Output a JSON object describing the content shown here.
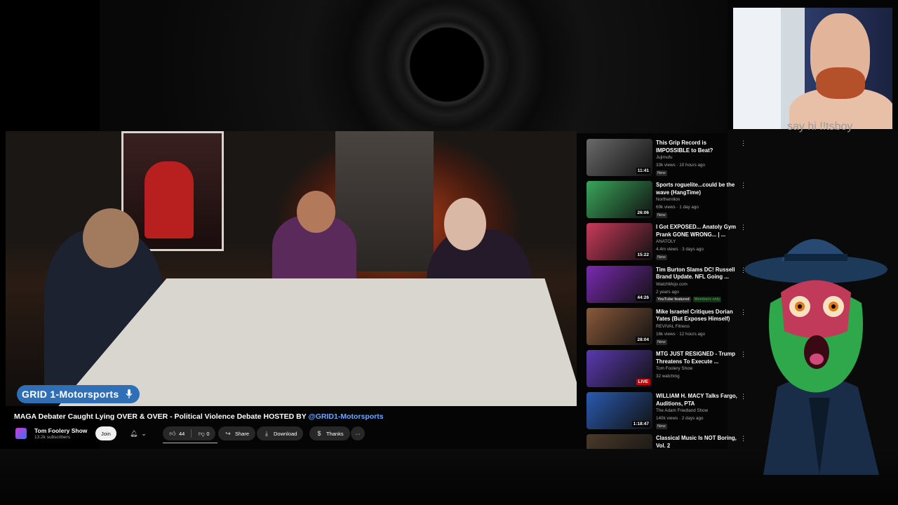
{
  "video": {
    "overlay_badge": "GRID 1-Motorsports",
    "title_main": "MAGA Debater Caught Lying OVER & OVER - Political Violence Debate HOSTED BY ",
    "title_tag": "@GRID1-Motorsports"
  },
  "channel": {
    "name": "Tom Foolery Show",
    "subscribers": "13.2k subscribers",
    "join_label": "Join"
  },
  "actions": {
    "likes": "44",
    "dislikes": "0",
    "share": "Share",
    "download": "Download",
    "thanks": "Thanks",
    "more": "···"
  },
  "webcam": {
    "caption": "say hi !!tsboy"
  },
  "recommendations": [
    {
      "title": "This Grip Record is IMPOSSIBLE to Beat?",
      "channel": "Jujimufu",
      "meta": "33k views · 10 hours ago",
      "badge": "New",
      "duration": "11:41",
      "thumb": "#6a6a6a"
    },
    {
      "title": "Sports roguelite...could be the wave (HangTime)",
      "channel": "Northernlion",
      "meta": "69k views · 1 day ago",
      "badge": "New",
      "duration": "26:06",
      "thumb": "#3aa55a"
    },
    {
      "title": "I Got EXPOSED... Anatoly Gym Prank GONE WRONG... | ...",
      "channel": "ANATOLY",
      "meta": "4.4m views · 3 days ago",
      "badge": "New",
      "duration": "15:22",
      "thumb": "#c93a5a"
    },
    {
      "title": "Tim Burton Slams DC! Russell Brand Update. NFL Going ...",
      "channel": "WatchMojo.com",
      "meta": "2 years ago",
      "yt_featured": "YouTube featured",
      "members": "Members only",
      "duration": "44:26",
      "thumb": "#7a2ab0"
    },
    {
      "title": "Mike Israetel Critiques Dorian Yates (But Exposes Himself)",
      "channel": "REVIVAL Fitness",
      "meta": "16k views · 12 hours ago",
      "badge": "New",
      "duration": "28:04",
      "thumb": "#8a5a3a"
    },
    {
      "title": "MTG JUST RESIGNED - Trump Threatens To Execute ...",
      "channel": "Tom Foolery Show",
      "meta": "32 watching",
      "duration": "LIVE",
      "thumb": "#5a3ab0"
    },
    {
      "title": "WILLIAM H. MACY Talks Fargo, Auditions, PTA",
      "channel": "The Adam Friedland Show",
      "meta": "140k views · 2 days ago",
      "badge": "New",
      "duration": "1:18:47",
      "thumb": "#2a5ab0"
    },
    {
      "title": "Classical Music Is NOT Boring, Vol. 2",
      "channel": "",
      "meta": "",
      "duration": "",
      "thumb": "#4a3a2a"
    }
  ],
  "colors": {
    "accent_blue": "#2f6fb8",
    "link": "#6ea8ff",
    "live_red": "#cc0000",
    "members_green": "#4caf50"
  }
}
